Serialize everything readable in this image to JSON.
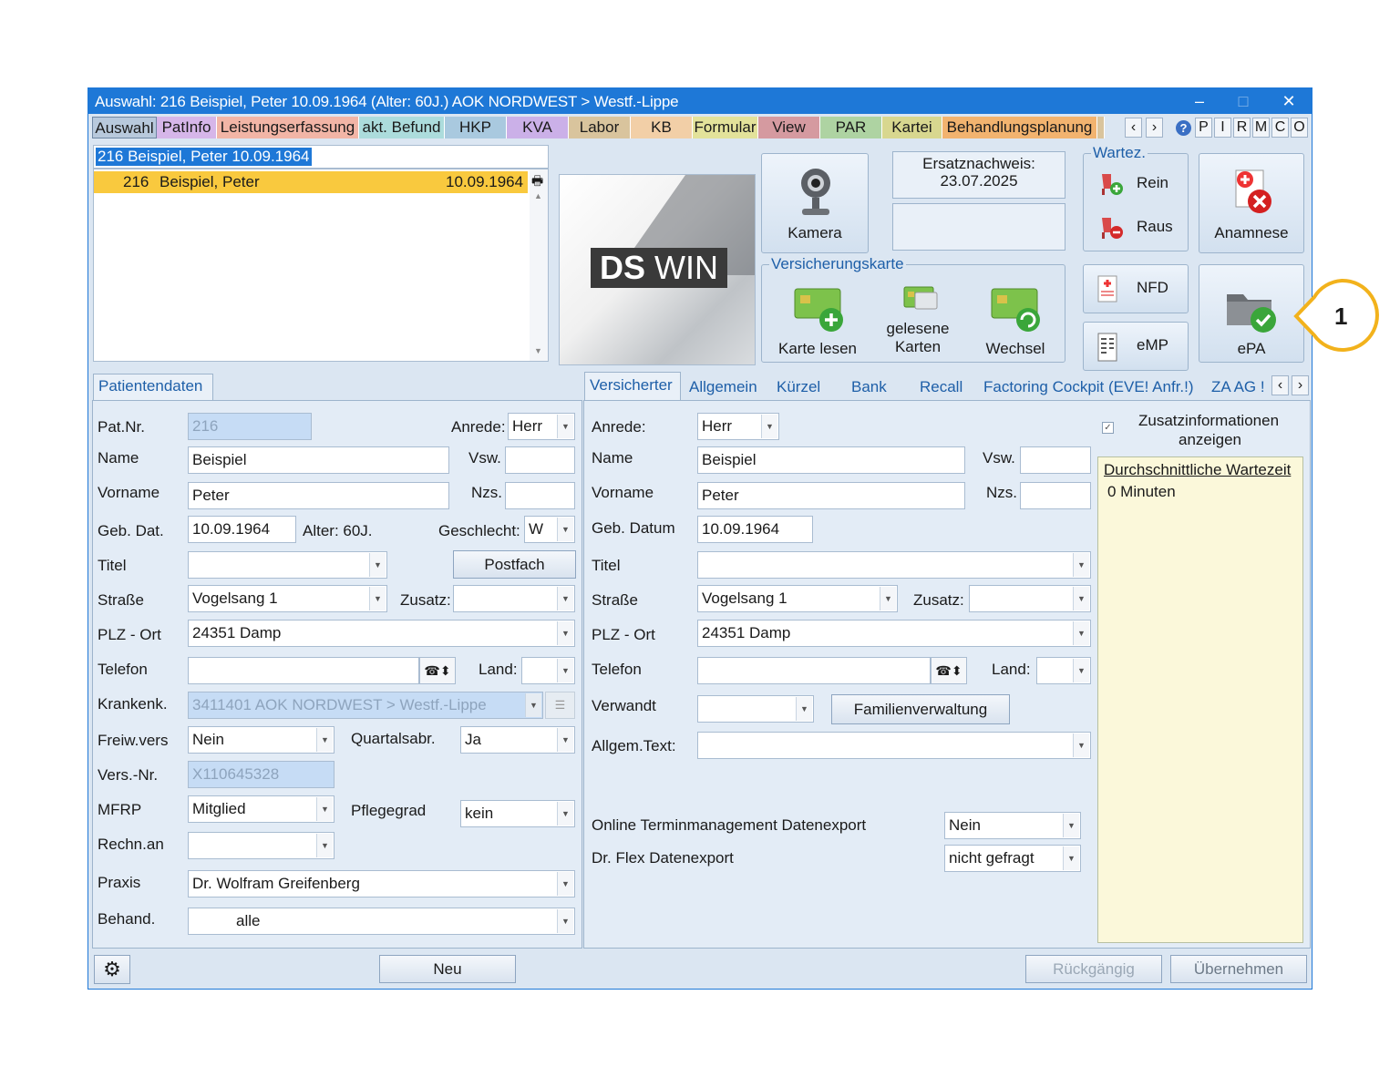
{
  "window": {
    "title": "Auswahl: 216  Beispiel, Peter  10.09.1964 (Alter: 60J.)  AOK NORDWEST > Westf.-Lippe",
    "minimize": "–",
    "maximize": "□",
    "close": "✕"
  },
  "tabs": [
    {
      "label": "Auswahl",
      "color": "#b8c9dc"
    },
    {
      "label": "PatInfo",
      "color": "#d6b6e9"
    },
    {
      "label": "Leistungserfassung",
      "color": "#f2b5a6"
    },
    {
      "label": "akt. Befund",
      "color": "#acdcdc"
    },
    {
      "label": "HKP",
      "color": "#a9c9df"
    },
    {
      "label": "KVA",
      "color": "#cbb0e8"
    },
    {
      "label": "Labor",
      "color": "#d9c49d"
    },
    {
      "label": "KB",
      "color": "#f2cfa7"
    },
    {
      "label": "Formular",
      "color": "#e3e29a"
    },
    {
      "label": "View",
      "color": "#d59aa0"
    },
    {
      "label": "PAR",
      "color": "#aed3a2"
    },
    {
      "label": "Kartei",
      "color": "#d8d78f"
    },
    {
      "label": "Behandlungsplanung",
      "color": "#f2b36f"
    }
  ],
  "tab_nav": {
    "prev": "‹",
    "next": "›",
    "help": "?",
    "letters": [
      "P",
      "I",
      "R",
      "M",
      "C",
      "O"
    ]
  },
  "search": {
    "value": "216 Beispiel, Peter  10.09.1964"
  },
  "patient_list": [
    {
      "nr": "216",
      "name": "Beispiel, Peter",
      "dob": "10.09.1964"
    }
  ],
  "logo": {
    "bold": "DS",
    "light": "WIN"
  },
  "buttons": {
    "kamera": "Kamera",
    "anamnese": "Anamnese",
    "rein": "Rein",
    "raus": "Raus",
    "nfd": "NFD",
    "emp": "eMP",
    "epa": "ePA",
    "karte_lesen": "Karte lesen",
    "gelesene_line1": "gelesene",
    "gelesene_line2": "Karten",
    "wechsel": "Wechsel",
    "postfach": "Postfach",
    "familienverwaltung": "Familienverwaltung",
    "neu": "Neu",
    "rueckgaengig": "Rückgängig",
    "uebernehmen": "Übernehmen"
  },
  "ersatz": {
    "label": "Ersatznachweis:",
    "date": "23.07.2025"
  },
  "groups": {
    "wartez": "Wartez.",
    "versicherungskarte": "Versicherungskarte"
  },
  "callout": {
    "number": "1"
  },
  "left_tab": "Patientendaten",
  "left": {
    "patnr_label": "Pat.Nr.",
    "patnr": "216",
    "anrede_label": "Anrede:",
    "anrede": "Herr",
    "name_label": "Name",
    "name": "Beispiel",
    "vsw_label": "Vsw.",
    "vorname_label": "Vorname",
    "vorname": "Peter",
    "nzs_label": "Nzs.",
    "geb_label": "Geb. Dat.",
    "geb": "10.09.1964",
    "alter": "Alter: 60J.",
    "geschlecht_label": "Geschlecht:",
    "geschlecht": "W",
    "titel_label": "Titel",
    "strasse_label": "Straße",
    "strasse": "Vogelsang 1",
    "zusatz_label": "Zusatz:",
    "plz_label": "PLZ - Ort",
    "plz": "24351 Damp",
    "telefon_label": "Telefon",
    "land_label": "Land:",
    "krankenk_label": "Krankenk.",
    "krankenk": "3411401 AOK NORDWEST > Westf.-Lippe",
    "freiw_label": "Freiw.vers",
    "freiw": "Nein",
    "quartal_label": "Quartalsabr.",
    "quartal": "Ja",
    "versnr_label": "Vers.-Nr.",
    "versnr": "X110645328",
    "mfrp_label": "MFRP",
    "mfrp": "Mitglied",
    "pflege_label": "Pflegegrad",
    "pflege": "kein",
    "rechn_label": "Rechn.an",
    "praxis_label": "Praxis",
    "praxis": "Dr. Wolfram Greifenberg",
    "behand_label": "Behand.",
    "behand": "alle"
  },
  "right_tabs": [
    "Versicherter",
    "Allgemein",
    "Kürzel",
    "Bank",
    "Recall",
    "Factoring Cockpit (EVE! Anfr.!)",
    "ZA AG !"
  ],
  "right": {
    "anrede_label": "Anrede:",
    "anrede": "Herr",
    "name_label": "Name",
    "name": "Beispiel",
    "vsw_label": "Vsw.",
    "vorname_label": "Vorname",
    "vorname": "Peter",
    "nzs_label": "Nzs.",
    "geb_label": "Geb. Datum",
    "geb": "10.09.1964",
    "titel_label": "Titel",
    "strasse_label": "Straße",
    "strasse": "Vogelsang 1",
    "zusatz_label": "Zusatz:",
    "plz_label": "PLZ - Ort",
    "plz": "24351 Damp",
    "telefon_label": "Telefon",
    "land_label": "Land:",
    "verwandt_label": "Verwandt",
    "allgem_label": "Allgem.Text:",
    "online_label": "Online Terminmanagement Datenexport",
    "online": "Nein",
    "drflex_label": "Dr. Flex Datenexport",
    "drflex": "nicht gefragt"
  },
  "zusatz": {
    "line1": "Zusatzinformationen",
    "line2": "anzeigen",
    "wartezeit_title": "Durchschnittliche Wartezeit",
    "wartezeit": "0 Minuten"
  }
}
